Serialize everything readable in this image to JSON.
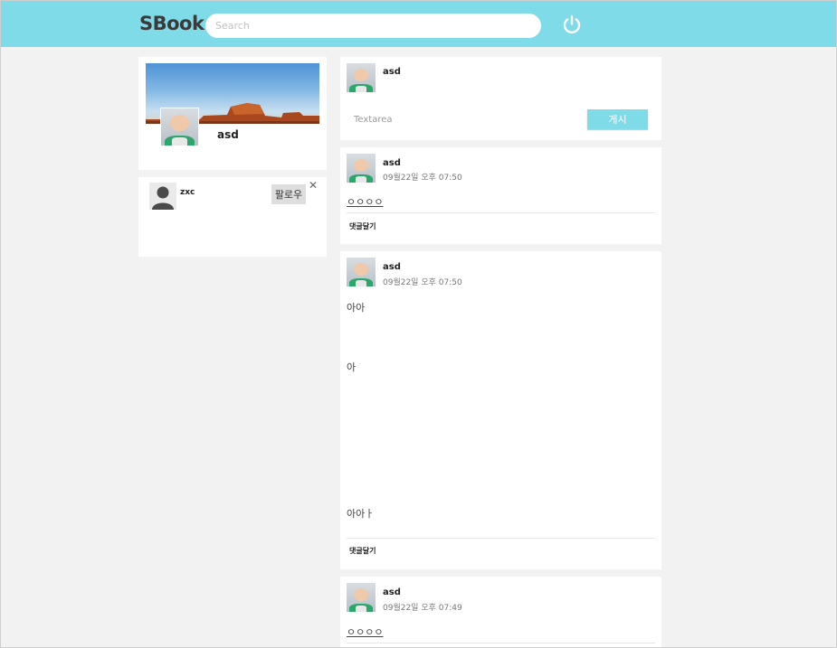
{
  "header": {
    "logo": "SBook",
    "search_placeholder": "Search",
    "power_icon": "power-icon"
  },
  "colors": {
    "accent": "#7fdbe8",
    "background": "#f2f2f2",
    "card": "#ffffff"
  },
  "profile": {
    "name": "asd"
  },
  "suggestion": {
    "name": "zxc",
    "follow_label": "팔로우",
    "close_label": "✕"
  },
  "composer": {
    "name": "asd",
    "placeholder": "Textarea",
    "submit_label": "게시"
  },
  "posts": [
    {
      "name": "asd",
      "time": "09월22일 오후 07:50",
      "lines": [
        "ㅇㅇㅇㅇ"
      ],
      "reply_label": "댓글달기"
    },
    {
      "name": "asd",
      "time": "09월22일 오후 07:50",
      "lines": [
        "아아",
        "아",
        "아아ㅏ"
      ],
      "reply_label": "댓글달기"
    },
    {
      "name": "asd",
      "time": "09월22일 오후 07:49",
      "lines": [
        "ㅇㅇㅇㅇ"
      ],
      "reply_label": ""
    }
  ]
}
